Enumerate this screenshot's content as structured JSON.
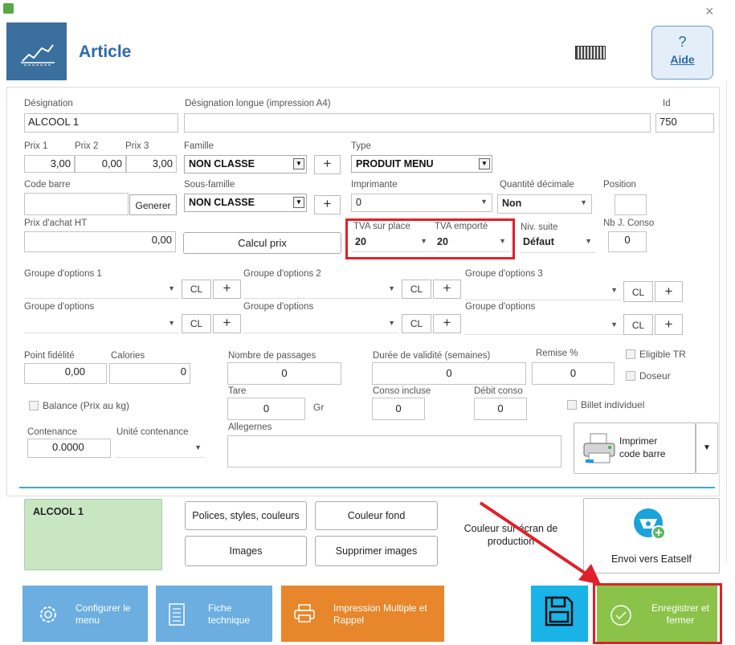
{
  "window": {
    "title": "Article",
    "help_label": "Aide",
    "help_glyph": "?",
    "close_glyph": "×"
  },
  "form": {
    "designation": {
      "label": "Désignation",
      "value": "ALCOOL 1"
    },
    "designation_longue": {
      "label": "Désignation longue (impression A4)",
      "value": ""
    },
    "id": {
      "label": "Id",
      "value": "750"
    },
    "prix": [
      {
        "label": "Prix 1",
        "value": "3,00"
      },
      {
        "label": "Prix 2",
        "value": "0,00"
      },
      {
        "label": "Prix 3",
        "value": "3,00"
      }
    ],
    "famille": {
      "label": "Famille",
      "value": "NON CLASSE"
    },
    "type": {
      "label": "Type",
      "value": "PRODUIT MENU"
    },
    "code_barre": {
      "label": "Code barre",
      "value": "",
      "button": "Generer"
    },
    "sous_famille": {
      "label": "Sous-famille",
      "value": "NON CLASSE"
    },
    "imprimante": {
      "label": "Imprimante",
      "value": "0"
    },
    "quantite_decimale": {
      "label": "Quantité décimale",
      "value": "Non"
    },
    "position": {
      "label": "Position",
      "value": ""
    },
    "prix_achat": {
      "label": "Prix d'achat HT",
      "value": "0,00"
    },
    "calcul_prix": "Calcul prix",
    "tva_sur_place": {
      "label": "TVA sur place",
      "value": "20"
    },
    "tva_emporte": {
      "label": "TVA emporté",
      "value": "20"
    },
    "niv_suite": {
      "label": "Niv. suite",
      "value": "Défaut"
    },
    "nb_conso": {
      "label": "Nb J. Conso",
      "value": "0"
    },
    "groupes_labels": [
      "Groupe d'options 1",
      "Groupe d'options 2",
      "Groupe d'options 3",
      "Groupe d'options",
      "Groupe d'options",
      "Groupe d'options"
    ],
    "cl_label": "CL",
    "plus_label": "+",
    "point_fidelite": {
      "label": "Point fidélité",
      "value": "0,00"
    },
    "calories": {
      "label": "Calories",
      "value": "0"
    },
    "nombre_passages": {
      "label": "Nombre de passages",
      "value": "0"
    },
    "duree_validite": {
      "label": "Durée de validité (semaines)",
      "value": "0"
    },
    "remise": {
      "label": "Remise %",
      "value": "0"
    },
    "eligible_tr": "Eligible TR",
    "doseur": "Doseur",
    "balance": "Balance (Prix au kg)",
    "tare": {
      "label": "Tare",
      "value": "0",
      "unit": "Gr"
    },
    "conso_incluse": {
      "label": "Conso incluse",
      "value": "0"
    },
    "debit_conso": {
      "label": "Débit conso",
      "value": "0"
    },
    "billet_individuel": "Billet individuel",
    "contenance": {
      "label": "Contenance",
      "value": "0.0000"
    },
    "unite_contenance": {
      "label": "Unité contenance",
      "value": ""
    },
    "allergenes": {
      "label": "Allegernes",
      "value": ""
    },
    "imprimer_code_barre": "Imprimer code barre"
  },
  "appearance": {
    "preview_text": "ALCOOL 1",
    "polices": "Polices, styles, couleurs",
    "couleur_fond": "Couleur fond",
    "images": "Images",
    "supprimer_images": "Supprimer images",
    "couleur_ecran": "Couleur sur écran de production",
    "envoi_eatself": "Envoi vers Eatself"
  },
  "actions": {
    "configurer": "Configurer le menu",
    "fiche": "Fiche technique",
    "impression": "Impression Multiple et Rappel",
    "enregistrer": "Enregistrer et fermer"
  },
  "colors": {
    "header_blue": "#3a6f9e",
    "title_blue": "#2c6aa8",
    "tile_blue": "#6baedf",
    "tile_orange": "#e8862b",
    "tile_cyan": "#19b3e8",
    "tile_green": "#8bc34a",
    "highlight_red": "#e0202a",
    "preview_green": "#c9e6c3"
  }
}
